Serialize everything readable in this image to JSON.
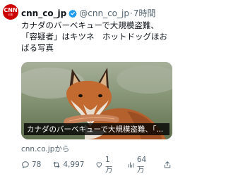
{
  "account": {
    "avatar_text": "CNN",
    "avatar_sub": "日本",
    "name": "cnn_co_jp",
    "handle": "@cnn_co_jp",
    "separator": "·",
    "time": "7時間"
  },
  "tweet": {
    "lines": [
      "カナダのバーベキューで大規模盗難、",
      "「容疑者」はキツネ　ホットドッグほお",
      "ばる写真"
    ]
  },
  "media": {
    "caption": "カナダのバーベキューで大規模盗難、「..."
  },
  "source_label": "cnn.co.jpから",
  "actions": {
    "replies": "78",
    "retweets": "4,997",
    "likes": "1万",
    "views": "64万"
  },
  "colors": {
    "accent": "#1d9bf0",
    "brand": "#cc0000",
    "muted": "#536471"
  }
}
